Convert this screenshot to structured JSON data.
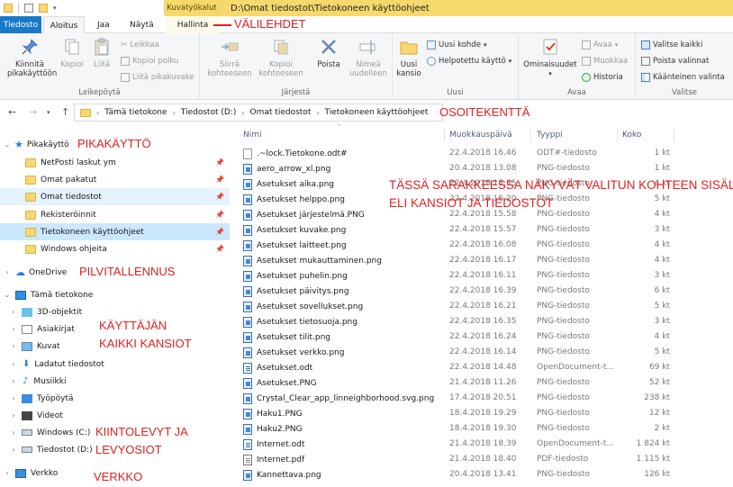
{
  "window": {
    "context_tab_label": "Kuvatyökalut",
    "title": "D:\\Omat tiedostot\\Tietokoneen käyttöohjeet"
  },
  "tabs": [
    {
      "label": "Tiedosto"
    },
    {
      "label": "Aloitus"
    },
    {
      "label": "Jaa"
    },
    {
      "label": "Näytä"
    },
    {
      "label": "Hallinta"
    }
  ],
  "ribbon": {
    "pikakaytto_label": "Kiinnitä pikakäyttöön",
    "copy_label": "Kopioi",
    "paste_label": "Liitä",
    "cut_label": "Leikkaa",
    "copy_path_label": "Kopioi polku",
    "paste_shortcut_label": "Liitä pikakuvake",
    "clipboard_group": "Leikepöytä",
    "move_to_label": "Siirrä kohteeseen",
    "copy_to_label": "Kopioi kohteeseen",
    "delete_label": "Poista",
    "rename_label": "Nimeä uudelleen",
    "organize_group": "Järjestä",
    "new_folder_label": "Uusi kansio",
    "new_item_label": "Uusi kohde",
    "easy_access_label": "Helpotettu käyttö",
    "new_group": "Uusi",
    "properties_label": "Ominaisuudet",
    "open_label": "Avaa",
    "edit_label": "Muokkaa",
    "history_label": "Historia",
    "open_group": "Avaa",
    "select_all_label": "Valitse kaikki",
    "select_none_label": "Poista valinnat",
    "invert_label": "Käänteinen valinta",
    "select_group": "Valitse"
  },
  "address": {
    "crumbs": [
      "Tämä tietokone",
      "Tiedostot (D:)",
      "Omat tiedostot",
      "Tietokoneen käyttöohjeet"
    ]
  },
  "nav": {
    "quick_access": "Pikakäyttö",
    "quick_items": [
      "NetPosti laskut ym",
      "Omat pakatut",
      "Omat tiedostot",
      "Rekisteröinnit",
      "Tietokoneen käyttöohjeet",
      "Windows ohjeita"
    ],
    "onedrive": "OneDrive",
    "this_pc": "Tämä tietokone",
    "pc_items": [
      "3D-objektit",
      "Asiakirjat",
      "Kuvat",
      "Ladatut tiedostot",
      "Musiikki",
      "Työpöytä",
      "Videot",
      "Windows (C:)",
      "Tiedostot (D:)"
    ],
    "network": "Verkko"
  },
  "columns": {
    "name": "Nimi",
    "modified": "Muokkauspäivä",
    "type": "Tyyppi",
    "size": "Koko"
  },
  "files": [
    {
      "name": ".~lock.Tietokone.odt#",
      "date": "22.4.2018 16.46",
      "type": "ODT#-tiedosto",
      "size": "1 kt",
      "icon": "lock"
    },
    {
      "name": "aero_arrow_xl.png",
      "date": "20.4.2018 13.08",
      "type": "PNG-tiedosto",
      "size": "1 kt",
      "icon": "png"
    },
    {
      "name": "Asetukset aika.png",
      "date": "22.4.2018 15.55",
      "type": "PNG-tiedosto",
      "size": "4 kt",
      "icon": "png"
    },
    {
      "name": "Asetukset helppo.png",
      "date": "22.4.2018 16.20",
      "type": "PNG-tiedosto",
      "size": "5 kt",
      "icon": "png"
    },
    {
      "name": "Asetukset järjestelmä.PNG",
      "date": "22.4.2018 15.58",
      "type": "PNG-tiedosto",
      "size": "4 kt",
      "icon": "png"
    },
    {
      "name": "Asetukset kuvake.png",
      "date": "22.4.2018 15.57",
      "type": "PNG-tiedosto",
      "size": "3 kt",
      "icon": "png"
    },
    {
      "name": "Asetukset laitteet.png",
      "date": "22.4.2018 16.08",
      "type": "PNG-tiedosto",
      "size": "4 kt",
      "icon": "png"
    },
    {
      "name": "Asetukset mukauttaminen.png",
      "date": "22.4.2018 16.17",
      "type": "PNG-tiedosto",
      "size": "4 kt",
      "icon": "png"
    },
    {
      "name": "Asetukset puhelin.png",
      "date": "22.4.2018 16.11",
      "type": "PNG-tiedosto",
      "size": "3 kt",
      "icon": "png"
    },
    {
      "name": "Asetukset päivitys.png",
      "date": "22.4.2018 16.39",
      "type": "PNG-tiedosto",
      "size": "6 kt",
      "icon": "png"
    },
    {
      "name": "Asetukset sovellukset.png",
      "date": "22.4.2018 16.21",
      "type": "PNG-tiedosto",
      "size": "5 kt",
      "icon": "png"
    },
    {
      "name": "Asetukset tietosuoja.png",
      "date": "22.4.2018 16.35",
      "type": "PNG-tiedosto",
      "size": "3 kt",
      "icon": "png"
    },
    {
      "name": "Asetukset tilit.png",
      "date": "22.4.2018 16.24",
      "type": "PNG-tiedosto",
      "size": "4 kt",
      "icon": "png"
    },
    {
      "name": "Asetukset verkko.png",
      "date": "22.4.2018 16.14",
      "type": "PNG-tiedosto",
      "size": "5 kt",
      "icon": "png"
    },
    {
      "name": "Asetukset.odt",
      "date": "22.4.2018 14.48",
      "type": "OpenDocument-t...",
      "size": "69 kt",
      "icon": "odt"
    },
    {
      "name": "Asetukset.PNG",
      "date": "21.4.2018 11.26",
      "type": "PNG-tiedosto",
      "size": "52 kt",
      "icon": "png"
    },
    {
      "name": "Crystal_Clear_app_linneighborhood.svg.png",
      "date": "17.4.2018 20.51",
      "type": "PNG-tiedosto",
      "size": "238 kt",
      "icon": "png"
    },
    {
      "name": "Haku1.PNG",
      "date": "18.4.2018 19.29",
      "type": "PNG-tiedosto",
      "size": "12 kt",
      "icon": "png"
    },
    {
      "name": "Haku2.PNG",
      "date": "18.4.2018 19.30",
      "type": "PNG-tiedosto",
      "size": "2 kt",
      "icon": "png"
    },
    {
      "name": "Internet.odt",
      "date": "21.4.2018 18.39",
      "type": "OpenDocument-t...",
      "size": "1 824 kt",
      "icon": "odt"
    },
    {
      "name": "Internet.pdf",
      "date": "21.4.2018 18.40",
      "type": "PDF-tiedosto",
      "size": "1 115 kt",
      "icon": "pdf"
    },
    {
      "name": "Kannettava.png",
      "date": "20.4.2018 13.41",
      "type": "PNG-tiedosto",
      "size": "126 kt",
      "icon": "png"
    }
  ],
  "annotations": {
    "tabs": "VÄLILEHDET",
    "address": "OSOITEKENTTÄ",
    "quick": "PIKAKÄYTTÖ",
    "cloud": "PILVITALLENNUS",
    "user1": "KÄYTTÄJÄN",
    "user2": "KAIKKI KANSIOT",
    "drives1": "KIINTOLEVYT JA",
    "drives2": "LEVYOSIOT",
    "network": "VERKKO",
    "content1": "TÄSSÄ SARAKKEESSA NÄKYVÄT VALITUN KOHTEEN SISÄLTÖ",
    "content2": "ELI KANSIOT JA TIEDOSTOT"
  },
  "colors": {
    "accent": "#1979ca",
    "annotation": "#e02020",
    "context_tab": "#f6d96c",
    "selection": "#cce8ff"
  }
}
